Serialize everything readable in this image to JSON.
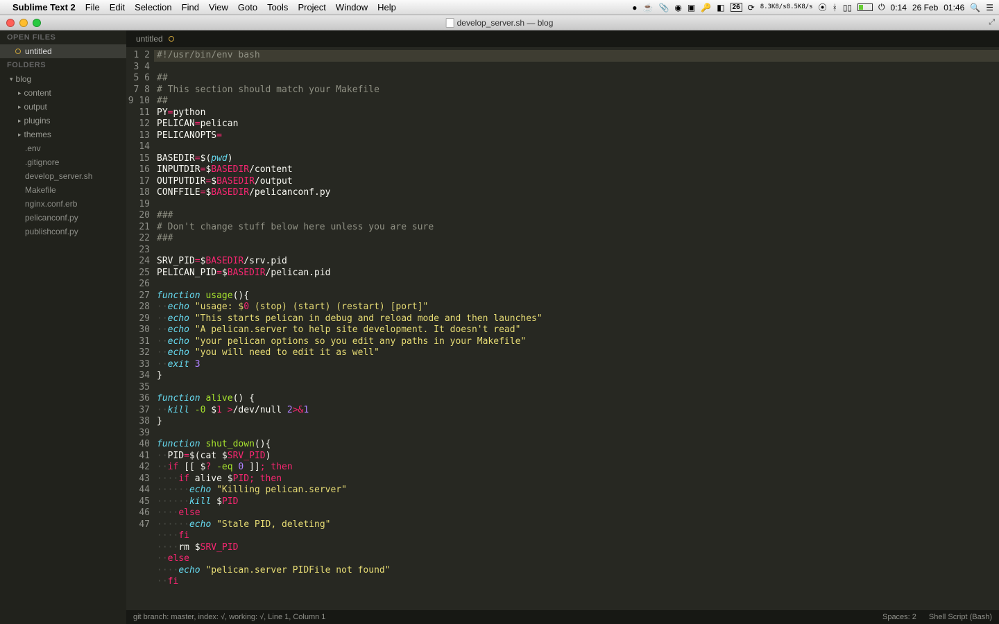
{
  "menubar": {
    "app_name": "Sublime Text 2",
    "items": [
      "File",
      "Edit",
      "Selection",
      "Find",
      "View",
      "Goto",
      "Tools",
      "Project",
      "Window",
      "Help"
    ],
    "net_up": "8.3K8/s",
    "net_dn": "8.5K8/s",
    "clock_small": "0:14",
    "date": "26 Feb",
    "clock_big": "01:46",
    "cal_day": "26"
  },
  "window": {
    "title": "develop_server.sh — blog"
  },
  "sidebar": {
    "open_files_hdr": "OPEN FILES",
    "open_files": [
      {
        "name": "untitled",
        "dirty": true
      }
    ],
    "folders_hdr": "FOLDERS",
    "root": "blog",
    "folders": [
      "content",
      "output",
      "plugins",
      "themes"
    ],
    "files": [
      ".env",
      ".gitignore",
      "develop_server.sh",
      "Makefile",
      "nginx.conf.erb",
      "pelicanconf.py",
      "publishconf.py"
    ]
  },
  "tabs": [
    {
      "name": "untitled",
      "dirty": true
    }
  ],
  "code": {
    "lines": [
      {
        "n": 1,
        "hl": true,
        "seg": [
          [
            "cm",
            "#!"
          ],
          [
            "cm",
            "/usr/bin/env bash"
          ]
        ]
      },
      {
        "n": 2,
        "seg": [
          [
            "cm",
            "##"
          ]
        ]
      },
      {
        "n": 3,
        "seg": [
          [
            "cm",
            "# This section should match your Makefile"
          ]
        ]
      },
      {
        "n": 4,
        "seg": [
          [
            "cm",
            "##"
          ]
        ]
      },
      {
        "n": 5,
        "seg": [
          [
            "pl",
            "PY"
          ],
          [
            "op",
            "="
          ],
          [
            "pl",
            "python"
          ]
        ]
      },
      {
        "n": 6,
        "seg": [
          [
            "pl",
            "PELICAN"
          ],
          [
            "op",
            "="
          ],
          [
            "pl",
            "pelican"
          ]
        ]
      },
      {
        "n": 7,
        "seg": [
          [
            "pl",
            "PELICANOPTS"
          ],
          [
            "op",
            "="
          ]
        ]
      },
      {
        "n": 8,
        "seg": [
          [
            "pl",
            ""
          ]
        ]
      },
      {
        "n": 9,
        "seg": [
          [
            "pl",
            "BASEDIR"
          ],
          [
            "op",
            "="
          ],
          [
            "pl",
            "$("
          ],
          [
            "kw",
            "pwd"
          ],
          [
            "pl",
            ")"
          ]
        ]
      },
      {
        "n": 10,
        "seg": [
          [
            "pl",
            "INPUTDIR"
          ],
          [
            "op",
            "="
          ],
          [
            "pl",
            "$"
          ],
          [
            "var",
            "BASEDIR"
          ],
          [
            "pl",
            "/content"
          ]
        ]
      },
      {
        "n": 11,
        "seg": [
          [
            "pl",
            "OUTPUTDIR"
          ],
          [
            "op",
            "="
          ],
          [
            "pl",
            "$"
          ],
          [
            "var",
            "BASEDIR"
          ],
          [
            "pl",
            "/output"
          ]
        ]
      },
      {
        "n": 12,
        "seg": [
          [
            "pl",
            "CONFFILE"
          ],
          [
            "op",
            "="
          ],
          [
            "pl",
            "$"
          ],
          [
            "var",
            "BASEDIR"
          ],
          [
            "pl",
            "/pelicanconf.py"
          ]
        ]
      },
      {
        "n": 13,
        "seg": [
          [
            "pl",
            ""
          ]
        ]
      },
      {
        "n": 14,
        "seg": [
          [
            "cm",
            "###"
          ]
        ]
      },
      {
        "n": 15,
        "seg": [
          [
            "cm",
            "# Don't change stuff below here unless you are sure"
          ]
        ]
      },
      {
        "n": 16,
        "seg": [
          [
            "cm",
            "###"
          ]
        ]
      },
      {
        "n": 17,
        "seg": [
          [
            "pl",
            ""
          ]
        ]
      },
      {
        "n": 18,
        "seg": [
          [
            "pl",
            "SRV_PID"
          ],
          [
            "op",
            "="
          ],
          [
            "pl",
            "$"
          ],
          [
            "var",
            "BASEDIR"
          ],
          [
            "pl",
            "/srv.pid"
          ]
        ]
      },
      {
        "n": 19,
        "seg": [
          [
            "pl",
            "PELICAN_PID"
          ],
          [
            "op",
            "="
          ],
          [
            "pl",
            "$"
          ],
          [
            "var",
            "BASEDIR"
          ],
          [
            "pl",
            "/pelican.pid"
          ]
        ]
      },
      {
        "n": 20,
        "seg": [
          [
            "pl",
            ""
          ]
        ]
      },
      {
        "n": 21,
        "seg": [
          [
            "kw",
            "function"
          ],
          [
            "pl",
            " "
          ],
          [
            "fn",
            "usage"
          ],
          [
            "pl",
            "(){"
          ]
        ]
      },
      {
        "n": 22,
        "seg": [
          [
            "dot",
            "··"
          ],
          [
            "kw",
            "echo"
          ],
          [
            "pl",
            " "
          ],
          [
            "str",
            "\"usage: $"
          ],
          [
            "var",
            "0"
          ],
          [
            "str",
            " (stop) (start) (restart) [port]\""
          ]
        ]
      },
      {
        "n": 23,
        "seg": [
          [
            "dot",
            "··"
          ],
          [
            "kw",
            "echo"
          ],
          [
            "pl",
            " "
          ],
          [
            "str",
            "\"This starts pelican in debug and reload mode and then launches\""
          ]
        ]
      },
      {
        "n": 24,
        "seg": [
          [
            "dot",
            "··"
          ],
          [
            "kw",
            "echo"
          ],
          [
            "pl",
            " "
          ],
          [
            "str",
            "\"A pelican.server to help site development. It doesn't read\""
          ]
        ]
      },
      {
        "n": 25,
        "seg": [
          [
            "dot",
            "··"
          ],
          [
            "kw",
            "echo"
          ],
          [
            "pl",
            " "
          ],
          [
            "str",
            "\"your pelican options so you edit any paths in your Makefile\""
          ]
        ]
      },
      {
        "n": 26,
        "seg": [
          [
            "dot",
            "··"
          ],
          [
            "kw",
            "echo"
          ],
          [
            "pl",
            " "
          ],
          [
            "str",
            "\"you will need to edit it as well\""
          ]
        ]
      },
      {
        "n": 27,
        "seg": [
          [
            "dot",
            "··"
          ],
          [
            "kw",
            "exit"
          ],
          [
            "pl",
            " "
          ],
          [
            "num",
            "3"
          ]
        ]
      },
      {
        "n": 28,
        "seg": [
          [
            "pl",
            "}"
          ]
        ]
      },
      {
        "n": 29,
        "seg": [
          [
            "pl",
            ""
          ]
        ]
      },
      {
        "n": 30,
        "seg": [
          [
            "kw",
            "function"
          ],
          [
            "pl",
            " "
          ],
          [
            "fn",
            "alive"
          ],
          [
            "pl",
            "() {"
          ]
        ]
      },
      {
        "n": 31,
        "seg": [
          [
            "dot",
            "··"
          ],
          [
            "kw",
            "kill"
          ],
          [
            "pl",
            " "
          ],
          [
            "fn",
            "-0"
          ],
          [
            "pl",
            " $"
          ],
          [
            "var",
            "1"
          ],
          [
            "pl",
            " "
          ],
          [
            "op",
            ">"
          ],
          [
            "pl",
            "/dev/null "
          ],
          [
            "num",
            "2"
          ],
          [
            "op",
            ">&"
          ],
          [
            "num",
            "1"
          ]
        ]
      },
      {
        "n": 32,
        "seg": [
          [
            "pl",
            "}"
          ]
        ]
      },
      {
        "n": 33,
        "seg": [
          [
            "pl",
            ""
          ]
        ]
      },
      {
        "n": 34,
        "seg": [
          [
            "kw",
            "function"
          ],
          [
            "pl",
            " "
          ],
          [
            "fn",
            "shut_down"
          ],
          [
            "pl",
            "(){"
          ]
        ]
      },
      {
        "n": 35,
        "seg": [
          [
            "dot",
            "··"
          ],
          [
            "pl",
            "PID"
          ],
          [
            "op",
            "="
          ],
          [
            "pl",
            "$(cat $"
          ],
          [
            "var",
            "SRV_PID"
          ],
          [
            "pl",
            ")"
          ]
        ]
      },
      {
        "n": 36,
        "seg": [
          [
            "dot",
            "··"
          ],
          [
            "op",
            "if"
          ],
          [
            "pl",
            " [[ $"
          ],
          [
            "var",
            "?"
          ],
          [
            "pl",
            " "
          ],
          [
            "fn",
            "-eq"
          ],
          [
            "pl",
            " "
          ],
          [
            "num",
            "0"
          ],
          [
            "pl",
            " ]]"
          ],
          [
            "op",
            ";"
          ],
          [
            "pl",
            " "
          ],
          [
            "op",
            "then"
          ]
        ]
      },
      {
        "n": 37,
        "seg": [
          [
            "dot",
            "····"
          ],
          [
            "op",
            "if"
          ],
          [
            "pl",
            " alive $"
          ],
          [
            "var",
            "PID"
          ],
          [
            "op",
            ";"
          ],
          [
            "pl",
            " "
          ],
          [
            "op",
            "then"
          ]
        ]
      },
      {
        "n": 38,
        "seg": [
          [
            "dot",
            "······"
          ],
          [
            "kw",
            "echo"
          ],
          [
            "pl",
            " "
          ],
          [
            "str",
            "\"Killing pelican.server\""
          ]
        ]
      },
      {
        "n": 39,
        "seg": [
          [
            "dot",
            "······"
          ],
          [
            "kw",
            "kill"
          ],
          [
            "pl",
            " $"
          ],
          [
            "var",
            "PID"
          ]
        ]
      },
      {
        "n": 40,
        "seg": [
          [
            "dot",
            "····"
          ],
          [
            "op",
            "else"
          ]
        ]
      },
      {
        "n": 41,
        "seg": [
          [
            "dot",
            "······"
          ],
          [
            "kw",
            "echo"
          ],
          [
            "pl",
            " "
          ],
          [
            "str",
            "\"Stale PID, deleting\""
          ]
        ]
      },
      {
        "n": 42,
        "seg": [
          [
            "dot",
            "····"
          ],
          [
            "op",
            "fi"
          ]
        ]
      },
      {
        "n": 43,
        "seg": [
          [
            "dot",
            "····"
          ],
          [
            "pl",
            "rm $"
          ],
          [
            "var",
            "SRV_PID"
          ]
        ]
      },
      {
        "n": 44,
        "seg": [
          [
            "dot",
            "··"
          ],
          [
            "op",
            "else"
          ]
        ]
      },
      {
        "n": 45,
        "seg": [
          [
            "dot",
            "····"
          ],
          [
            "kw",
            "echo"
          ],
          [
            "pl",
            " "
          ],
          [
            "str",
            "\"pelican.server PIDFile not found\""
          ]
        ]
      },
      {
        "n": 46,
        "seg": [
          [
            "dot",
            "··"
          ],
          [
            "op",
            "fi"
          ]
        ]
      },
      {
        "n": 47,
        "seg": [
          [
            "pl",
            ""
          ]
        ]
      }
    ]
  },
  "status": {
    "left": "git branch: master, index: √, working: √, Line 1, Column 1",
    "spaces": "Spaces: 2",
    "syntax": "Shell Script (Bash)"
  }
}
